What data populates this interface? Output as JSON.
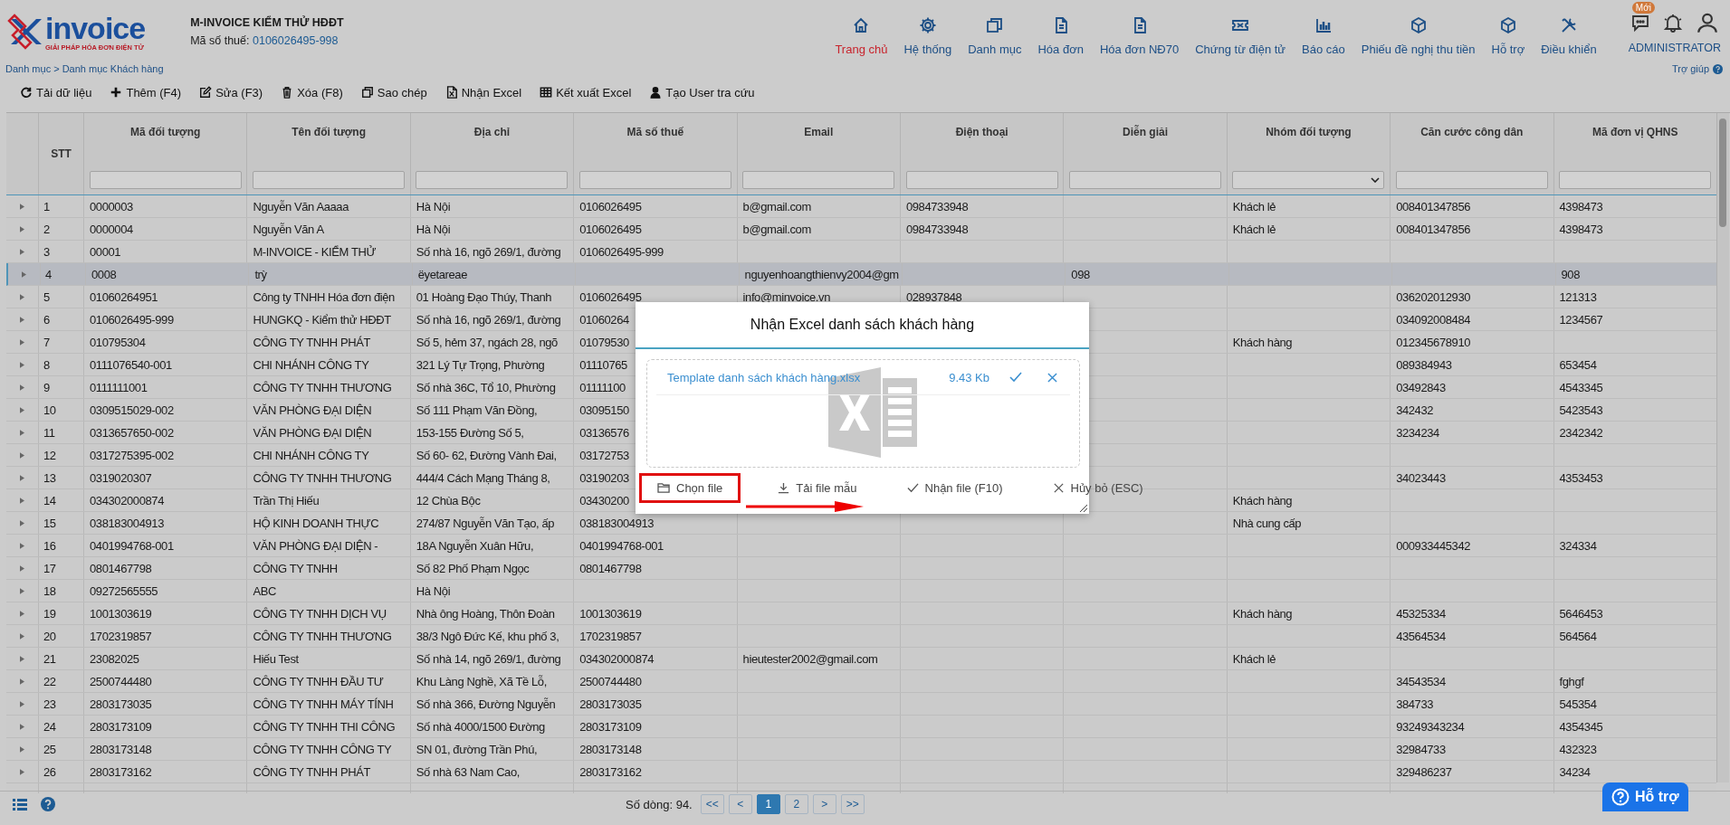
{
  "header": {
    "logo_text": "invoice",
    "logo_tagline": "GIẢI PHÁP HÓA ĐƠN ĐIỆN TỬ",
    "company": "M-INVOICE KIỂM THỬ HĐĐT",
    "tax_label": "Mã số thuế:",
    "tax_code": "0106026495-998",
    "breadcrumb": "Danh mục > Danh mục Khách hàng",
    "help": "Trợ giúp"
  },
  "nav": [
    {
      "label": "Trang chủ",
      "selected": true
    },
    {
      "label": "Hệ thống",
      "selected": false
    },
    {
      "label": "Danh mục",
      "selected": false
    },
    {
      "label": "Hóa đơn",
      "selected": false
    },
    {
      "label": "Hóa đơn NĐ70",
      "selected": false
    },
    {
      "label": "Chứng từ điện tử",
      "selected": false
    },
    {
      "label": "Báo cáo",
      "selected": false
    },
    {
      "label": "Phiếu đề nghị thu tiền",
      "selected": false
    },
    {
      "label": "Hỗ trợ",
      "selected": false
    },
    {
      "label": "Điều khiển",
      "selected": false
    }
  ],
  "user": {
    "badge": "Mới",
    "name": "ADMINISTRATOR"
  },
  "toolbar": [
    "Tải dữ liệu",
    "Thêm (F4)",
    "Sửa (F3)",
    "Xóa (F8)",
    "Sao chép",
    "Nhận Excel",
    "Kết xuất Excel",
    "Tạo User tra cứu"
  ],
  "table": {
    "stt_label": "STT",
    "columns": [
      "Mã đối tượng",
      "Tên đối tượng",
      "Địa chỉ",
      "Mã số thuế",
      "Email",
      "Điện thoại",
      "Diễn giải",
      "Nhóm đối tượng",
      "Căn cước công dân",
      "Mã đơn vị QHNS"
    ],
    "filters": [
      {
        "kind": "text"
      },
      {
        "kind": "text"
      },
      {
        "kind": "text"
      },
      {
        "kind": "text"
      },
      {
        "kind": "text"
      },
      {
        "kind": "text"
      },
      {
        "kind": "text"
      },
      {
        "kind": "select"
      },
      {
        "kind": "text"
      },
      {
        "kind": "text"
      }
    ],
    "rows": [
      {
        "selected": false,
        "stt": "1",
        "ma_doi_tuong": "0000003",
        "ten_doi_tuong": "Nguyễn Văn Aaaaa",
        "dia_chi": "Hà Nội",
        "ma_so_thue": "0106026495",
        "email": "b@gmail.com",
        "dien_thoai": "0984733948",
        "nhom_doi_tuong": "Khách lẻ",
        "can_cuoc": "008401347856",
        "ma_don_vi": "4398473"
      },
      {
        "selected": false,
        "stt": "2",
        "ma_doi_tuong": "0000004",
        "ten_doi_tuong": "Nguyễn Văn A",
        "dia_chi": "Hà Nội",
        "ma_so_thue": "0106026495",
        "email": "b@gmail.com",
        "dien_thoai": "0984733948",
        "nhom_doi_tuong": "Khách lẻ",
        "can_cuoc": "008401347856",
        "ma_don_vi": "4398473"
      },
      {
        "selected": false,
        "stt": "3",
        "ma_doi_tuong": "00001",
        "ten_doi_tuong": "M-INVOICE - KIỂM THỬ",
        "dia_chi": "Số nhà 16, ngõ 269/1, đường",
        "ma_so_thue": "0106026495-999"
      },
      {
        "selected": true,
        "stt": "4",
        "ma_doi_tuong": "0008",
        "ten_doi_tuong": "trỳ",
        "dia_chi": "ëyetareae",
        "email": "nguyenhoangthienvy2004@gm",
        "dien_giai": "098",
        "ma_don_vi": "908"
      },
      {
        "selected": false,
        "stt": "5",
        "ma_doi_tuong": "01060264951",
        "ten_doi_tuong": "Công ty TNHH Hóa đơn điện",
        "dia_chi": "01 Hoàng Đạo Thúy, Thanh",
        "ma_so_thue": "0106026495",
        "email": "info@minvoice.vn",
        "dien_thoai": "028937848",
        "can_cuoc": "036202012930",
        "ma_don_vi": "121313"
      },
      {
        "selected": false,
        "stt": "6",
        "ma_doi_tuong": "0106026495-999",
        "ten_doi_tuong": "HUNGKQ - Kiểm thử HĐĐT",
        "dia_chi": "Số nhà 16, ngõ 269/1, đường",
        "ma_so_thue": "01060264",
        "can_cuoc": "034092008484",
        "ma_don_vi": "1234567"
      },
      {
        "selected": false,
        "stt": "7",
        "ma_doi_tuong": "010795304",
        "ten_doi_tuong": "CÔNG TY TNHH PHÁT",
        "dia_chi": "Số 5, hẻm 37, ngách 28, ngõ",
        "ma_so_thue": "01079530",
        "nhom_doi_tuong": "Khách hàng",
        "can_cuoc": "012345678910"
      },
      {
        "selected": false,
        "stt": "8",
        "ma_doi_tuong": "0111076540-001",
        "ten_doi_tuong": "CHI NHÁNH CÔNG TY",
        "dia_chi": "321 Lý Tự Trọng, Phường",
        "ma_so_thue": "01110765",
        "can_cuoc": "089384943",
        "ma_don_vi": "653454"
      },
      {
        "selected": false,
        "stt": "9",
        "ma_doi_tuong": "0111111001",
        "ten_doi_tuong": "CÔNG TY TNHH THƯƠNG",
        "dia_chi": "Số nhà 36C, Tổ 10, Phường",
        "ma_so_thue": "01111100",
        "can_cuoc": "03492843",
        "ma_don_vi": "4543345"
      },
      {
        "selected": false,
        "stt": "10",
        "ma_doi_tuong": "0309515029-002",
        "ten_doi_tuong": "VĂN PHÒNG ĐẠI DIỆN",
        "dia_chi": "Số 111 Phạm Văn Đồng,",
        "ma_so_thue": "03095150",
        "can_cuoc": "342432",
        "ma_don_vi": "5423543"
      },
      {
        "selected": false,
        "stt": "11",
        "ma_doi_tuong": "0313657650-002",
        "ten_doi_tuong": "VĂN PHÒNG ĐẠI DIỆN",
        "dia_chi": "153-155 Đường Số 5,",
        "ma_so_thue": "03136576",
        "can_cuoc": "3234234",
        "ma_don_vi": "2342342"
      },
      {
        "selected": false,
        "stt": "12",
        "ma_doi_tuong": "0317275395-002",
        "ten_doi_tuong": "CHI NHÁNH CÔNG TY",
        "dia_chi": "Số 60- 62, Đường Vành Đai,",
        "ma_so_thue": "03172753"
      },
      {
        "selected": false,
        "stt": "13",
        "ma_doi_tuong": "0319020307",
        "ten_doi_tuong": "CÔNG TY TNHH THƯƠNG",
        "dia_chi": "444/4 Cách Mạng Tháng 8,",
        "ma_so_thue": "03190203",
        "can_cuoc": "34023443",
        "ma_don_vi": "4353453"
      },
      {
        "selected": false,
        "stt": "14",
        "ma_doi_tuong": "034302000874",
        "ten_doi_tuong": "Trần Thị Hiếu",
        "dia_chi": "12 Chùa Bộc",
        "ma_so_thue": "03430200",
        "nhom_doi_tuong": "Khách hàng"
      },
      {
        "selected": false,
        "stt": "15",
        "ma_doi_tuong": "038183004913",
        "ten_doi_tuong": "HỘ KINH DOANH THỰC",
        "dia_chi": "274/87 Nguyễn Văn Tạo, ấp",
        "ma_so_thue": "038183004913",
        "nhom_doi_tuong": "Nhà cung cấp"
      },
      {
        "selected": false,
        "stt": "16",
        "ma_doi_tuong": "0401994768-001",
        "ten_doi_tuong": "VĂN PHÒNG ĐẠI DIỆN -",
        "dia_chi": "18A Nguyễn Xuân Hữu,",
        "ma_so_thue": "0401994768-001",
        "can_cuoc": "000933445342",
        "ma_don_vi": "324334"
      },
      {
        "selected": false,
        "stt": "17",
        "ma_doi_tuong": "0801467798",
        "ten_doi_tuong": "CÔNG TY TNHH",
        "dia_chi": "Số 82 Phố Phạm Ngọc",
        "ma_so_thue": "0801467798"
      },
      {
        "selected": false,
        "stt": "18",
        "ma_doi_tuong": "09272565555",
        "ten_doi_tuong": "ABC",
        "dia_chi": "Hà Nội"
      },
      {
        "selected": false,
        "stt": "19",
        "ma_doi_tuong": "1001303619",
        "ten_doi_tuong": "CÔNG TY TNHH DỊCH VỤ",
        "dia_chi": "Nhà ông Hoàng, Thôn Đoàn",
        "ma_so_thue": "1001303619",
        "nhom_doi_tuong": "Khách hàng",
        "can_cuoc": "45325334",
        "ma_don_vi": "5646453"
      },
      {
        "selected": false,
        "stt": "20",
        "ma_doi_tuong": "1702319857",
        "ten_doi_tuong": "CÔNG TY TNHH THƯƠNG",
        "dia_chi": "38/3 Ngô Đức Kế, khu phố 3,",
        "ma_so_thue": "1702319857",
        "can_cuoc": "43564534",
        "ma_don_vi": "564564"
      },
      {
        "selected": false,
        "stt": "21",
        "ma_doi_tuong": "23082025",
        "ten_doi_tuong": "Hiếu Test",
        "dia_chi": "Số nhà 14, ngõ 269/1, đường",
        "ma_so_thue": "034302000874",
        "email": "hieutester2002@gmail.com",
        "nhom_doi_tuong": "Khách lẻ"
      },
      {
        "selected": false,
        "stt": "22",
        "ma_doi_tuong": "2500744480",
        "ten_doi_tuong": "CÔNG TY TNHH ĐẦU TƯ",
        "dia_chi": "Khu Làng Nghề, Xã Tề Lỗ,",
        "ma_so_thue": "2500744480",
        "can_cuoc": "34543534",
        "ma_don_vi": "fghgf"
      },
      {
        "selected": false,
        "stt": "23",
        "ma_doi_tuong": "2803173035",
        "ten_doi_tuong": "CÔNG TY TNHH MÁY TÍNH",
        "dia_chi": "Số nhà 366, Đường Nguyễn",
        "ma_so_thue": "2803173035",
        "can_cuoc": "384733",
        "ma_don_vi": "545354"
      },
      {
        "selected": false,
        "stt": "24",
        "ma_doi_tuong": "2803173109",
        "ten_doi_tuong": "CÔNG TY TNHH THI CÔNG",
        "dia_chi": "Số nhà 4000/1500 Đường",
        "ma_so_thue": "2803173109",
        "can_cuoc": "93249343234",
        "ma_don_vi": "4354345"
      },
      {
        "selected": false,
        "stt": "25",
        "ma_doi_tuong": "2803173148",
        "ten_doi_tuong": "CÔNG TY TNHH CÔNG TY",
        "dia_chi": "SN 01, đường Trần Phú,",
        "ma_so_thue": "2803173148",
        "can_cuoc": "32984733",
        "ma_don_vi": "432323"
      },
      {
        "selected": false,
        "stt": "26",
        "ma_doi_tuong": "2803173162",
        "ten_doi_tuong": "CÔNG TY TNHH PHÁT",
        "dia_chi": "Số nhà 63 Nam Cao,",
        "ma_so_thue": "2803173162",
        "can_cuoc": "329486237",
        "ma_don_vi": "34234"
      }
    ]
  },
  "footer": {
    "row_count": "Số dòng: 94.",
    "pages": [
      {
        "label": "<<",
        "selected": false
      },
      {
        "label": "<",
        "selected": false
      },
      {
        "label": "1",
        "selected": true
      },
      {
        "label": "2",
        "selected": false
      },
      {
        "label": ">",
        "selected": false
      },
      {
        "label": ">>",
        "selected": false
      }
    ]
  },
  "support_button": "Hỗ trợ",
  "dialog": {
    "title": "Nhận Excel danh sách khách hàng",
    "file": {
      "name": "Template danh sách khách hàng.xlsx",
      "size": "9.43 Kb"
    },
    "buttons": [
      {
        "label": "Chọn file",
        "highlighted": true
      },
      {
        "label": "Tải file mẫu",
        "highlighted": false
      },
      {
        "label": "Nhận file (F10)",
        "highlighted": false
      },
      {
        "label": "Hủy bỏ (ESC)",
        "highlighted": false
      }
    ],
    "arrow": true
  }
}
